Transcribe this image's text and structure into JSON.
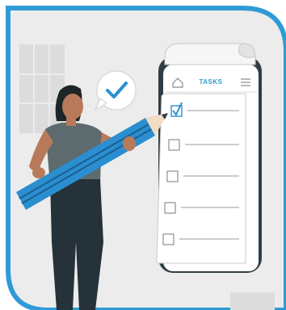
{
  "phone": {
    "header_title": "TASKS",
    "header_left_icon": "home-icon",
    "header_right_icon": "menu-icon"
  },
  "tasks": {
    "items": [
      {
        "checked": true
      },
      {
        "checked": false
      },
      {
        "checked": false
      },
      {
        "checked": false
      },
      {
        "checked": false
      }
    ]
  },
  "speech_bubble": {
    "icon": "checkmark-icon"
  },
  "colors": {
    "frame_border": "#2f9bd6",
    "background": "#ececec",
    "accent_blue": "#2a8fd0",
    "phone_dark": "#2f3e46",
    "clothes_dark": "#25323a"
  }
}
